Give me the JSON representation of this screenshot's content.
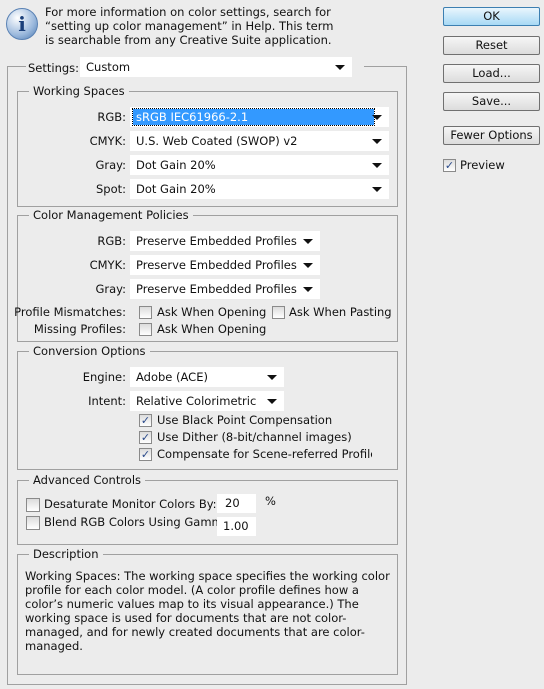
{
  "info": {
    "icon": "info-icon",
    "message": "For more information on color settings, search for “setting up color management” in Help. This term is searchable from any Creative Suite application."
  },
  "buttons": {
    "ok": "OK",
    "reset": "Reset",
    "load": "Load...",
    "save": "Save...",
    "fewer": "Fewer Options"
  },
  "preview": {
    "label": "Preview",
    "checked": true
  },
  "settings": {
    "label": "Settings:",
    "value": "Custom"
  },
  "working_spaces": {
    "title": "Working Spaces",
    "rgb_label": "RGB:",
    "rgb": "sRGB IEC61966-2.1",
    "cmyk_label": "CMYK:",
    "cmyk": "U.S. Web Coated (SWOP) v2",
    "gray_label": "Gray:",
    "gray": "Dot Gain 20%",
    "spot_label": "Spot:",
    "spot": "Dot Gain 20%"
  },
  "policies": {
    "title": "Color Management Policies",
    "rgb_label": "RGB:",
    "rgb": "Preserve Embedded Profiles",
    "cmyk_label": "CMYK:",
    "cmyk": "Preserve Embedded Profiles",
    "gray_label": "Gray:",
    "gray": "Preserve Embedded Profiles",
    "mismatch_label": "Profile Mismatches:",
    "ask_open": "Ask When Opening",
    "ask_paste": "Ask When Pasting",
    "missing_label": "Missing Profiles:",
    "missing_ask_open": "Ask When Opening"
  },
  "conversion": {
    "title": "Conversion Options",
    "engine_label": "Engine:",
    "engine": "Adobe (ACE)",
    "intent_label": "Intent:",
    "intent": "Relative Colorimetric",
    "bpc": "Use Black Point Compensation",
    "dither": "Use Dither (8-bit/channel images)",
    "scene": "Compensate for Scene-referred Profiles"
  },
  "advanced": {
    "title": "Advanced Controls",
    "desat_label": "Desaturate Monitor Colors By:",
    "desat_value": "20",
    "desat_unit": "%",
    "blend_label": "Blend RGB Colors Using Gamma:",
    "blend_value": "1.00"
  },
  "description": {
    "title": "Description",
    "text": "Working Spaces:  The working space specifies the working color profile for each color model.  (A color profile defines how a color’s numeric values map to its visual appearance.)  The working space is used for documents that are not color-managed, and for newly created documents that are color-managed."
  }
}
